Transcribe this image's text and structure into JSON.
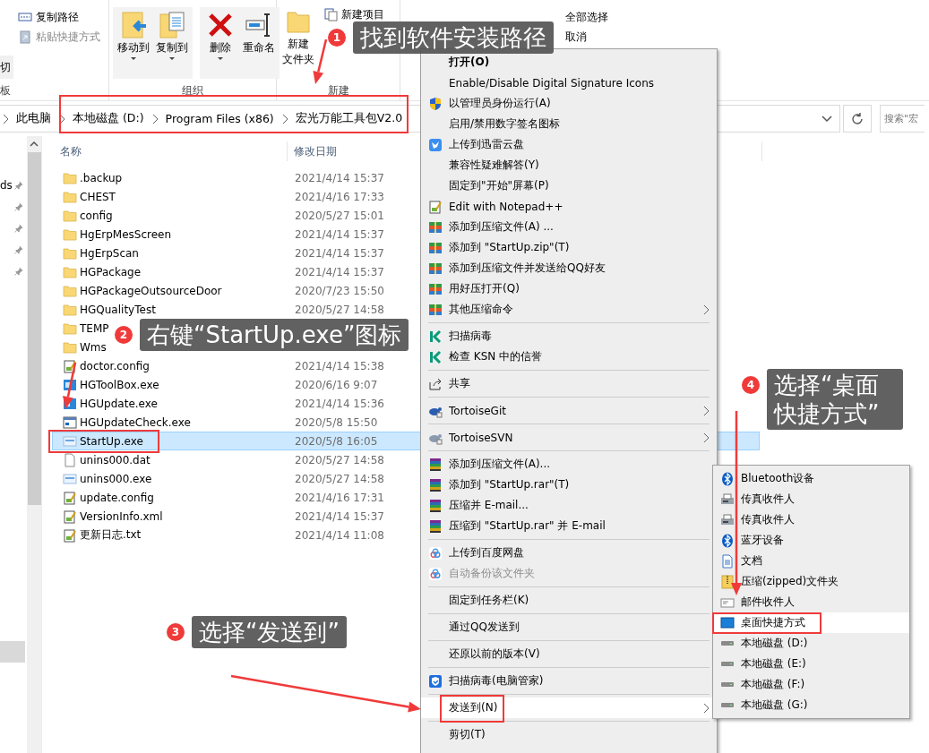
{
  "ribbon": {
    "clipboard": {
      "items": [
        {
          "label": "复制路径",
          "disabled": false
        },
        {
          "label": "粘贴快捷方式",
          "disabled": true
        }
      ],
      "cut": "切",
      "group_label": "板"
    },
    "organize": {
      "buttons": [
        {
          "label": "移动到",
          "dropdown": true
        },
        {
          "label": "复制到",
          "dropdown": true
        },
        {
          "label": "删除",
          "dropdown": true
        },
        {
          "label": "重命名",
          "dropdown": false
        }
      ],
      "group_label": "组织"
    },
    "new": {
      "folder_button": [
        "新建",
        "文件夹"
      ],
      "new_item": "新建项目",
      "group_label": "新建"
    },
    "select": {
      "items": [
        "全部选择",
        "取消"
      ]
    }
  },
  "address_bar": {
    "crumbs": [
      "此电脑",
      "本地磁盘 (D:)",
      "Program Files (x86)",
      "宏光万能工具包V2.0"
    ],
    "search_placeholder": "搜索\"宏"
  },
  "nav_pane": {
    "label": "ds"
  },
  "file_list": {
    "columns": [
      "名称",
      "修改日期"
    ],
    "rows": [
      {
        "name": ".backup",
        "date": "2021/4/14 15:37",
        "kind": "folder",
        "selected": false
      },
      {
        "name": "CHEST",
        "date": "2021/4/16 17:33",
        "kind": "folder",
        "selected": false
      },
      {
        "name": "config",
        "date": "2020/5/27 15:01",
        "kind": "folder",
        "selected": false
      },
      {
        "name": "HgErpMesScreen",
        "date": "2021/4/14 15:37",
        "kind": "folder",
        "selected": false
      },
      {
        "name": "HgErpScan",
        "date": "2021/4/14 15:37",
        "kind": "folder",
        "selected": false
      },
      {
        "name": "HGPackage",
        "date": "2021/4/14 15:37",
        "kind": "folder",
        "selected": false
      },
      {
        "name": "HGPackageOutsourceDoor",
        "date": "2020/7/23 15:50",
        "kind": "folder",
        "selected": false
      },
      {
        "name": "HGQualityTest",
        "date": "2020/5/27 14:58",
        "kind": "folder",
        "selected": false
      },
      {
        "name": "TEMP",
        "kind": "folder",
        "selected": false
      },
      {
        "name": "Wms",
        "kind": "folder",
        "selected": false
      },
      {
        "name": "doctor.config",
        "date": "2021/4/14 15:38",
        "kind": "config",
        "selected": false
      },
      {
        "name": "HGToolBox.exe",
        "date": "2020/6/16 9:07",
        "kind": "exe",
        "selected": false
      },
      {
        "name": "HGUpdate.exe",
        "date": "2021/4/14 15:36",
        "kind": "exe",
        "selected": false
      },
      {
        "name": "HGUpdateCheck.exe",
        "date": "2020/5/8 15:50",
        "kind": "window",
        "selected": false
      },
      {
        "name": "StartUp.exe",
        "date": "2020/5/8 16:05",
        "kind": "app",
        "selected": true
      },
      {
        "name": "unins000.dat",
        "date": "2020/5/27 14:58",
        "kind": "data",
        "selected": false
      },
      {
        "name": "unins000.exe",
        "date": "2020/5/27 14:58",
        "kind": "app",
        "selected": false
      },
      {
        "name": "update.config",
        "date": "2021/4/16 17:31",
        "kind": "config",
        "selected": false
      },
      {
        "name": "VersionInfo.xml",
        "date": "2021/4/14 15:37",
        "kind": "config",
        "selected": false
      },
      {
        "name": "更新日志.txt",
        "date": "2021/4/14 11:08",
        "kind": "config",
        "selected": false
      }
    ]
  },
  "context_menu": {
    "items": [
      {
        "kind": "item",
        "label": "打开(O)",
        "default": true,
        "disabled": false,
        "selected": false,
        "submenu": false
      },
      {
        "kind": "item",
        "label": "Enable/Disable Digital Signature Icons",
        "default": false,
        "disabled": false,
        "selected": false,
        "submenu": false
      },
      {
        "kind": "item",
        "label": "以管理员身份运行(A)",
        "default": false,
        "disabled": false,
        "selected": false,
        "submenu": false
      },
      {
        "kind": "item",
        "label": "启用/禁用数字签名图标",
        "default": false,
        "disabled": false,
        "selected": false,
        "submenu": false
      },
      {
        "kind": "item",
        "label": "上传到迅雷云盘",
        "default": false,
        "disabled": false,
        "selected": false,
        "submenu": false
      },
      {
        "kind": "item",
        "label": "兼容性疑难解答(Y)",
        "default": false,
        "disabled": false,
        "selected": false,
        "submenu": false
      },
      {
        "kind": "item",
        "label": "固定到\"开始\"屏幕(P)",
        "default": false,
        "disabled": false,
        "selected": false,
        "submenu": false
      },
      {
        "kind": "item",
        "label": "Edit with Notepad++",
        "default": false,
        "disabled": false,
        "selected": false,
        "submenu": false
      },
      {
        "kind": "item",
        "label": "添加到压缩文件(A) ...",
        "default": false,
        "disabled": false,
        "selected": false,
        "submenu": false
      },
      {
        "kind": "item",
        "label": "添加到 \"StartUp.zip\"(T)",
        "default": false,
        "disabled": false,
        "selected": false,
        "submenu": false
      },
      {
        "kind": "item",
        "label": "添加到压缩文件并发送给QQ好友",
        "default": false,
        "disabled": false,
        "selected": false,
        "submenu": false
      },
      {
        "kind": "item",
        "label": "用好压打开(Q)",
        "default": false,
        "disabled": false,
        "selected": false,
        "submenu": false
      },
      {
        "kind": "item",
        "label": "其他压缩命令",
        "default": false,
        "disabled": false,
        "selected": false,
        "submenu": true
      },
      {
        "kind": "separator"
      },
      {
        "kind": "item",
        "label": "扫描病毒",
        "default": false,
        "disabled": false,
        "selected": false,
        "submenu": false
      },
      {
        "kind": "item",
        "label": "检查 KSN 中的信誉",
        "default": false,
        "disabled": false,
        "selected": false,
        "submenu": false
      },
      {
        "kind": "separator"
      },
      {
        "kind": "item",
        "label": "共享",
        "default": false,
        "disabled": false,
        "selected": false,
        "submenu": false
      },
      {
        "kind": "separator"
      },
      {
        "kind": "item",
        "label": "TortoiseGit",
        "default": false,
        "disabled": false,
        "selected": false,
        "submenu": true
      },
      {
        "kind": "separator"
      },
      {
        "kind": "item",
        "label": "TortoiseSVN",
        "default": false,
        "disabled": false,
        "selected": false,
        "submenu": true
      },
      {
        "kind": "separator"
      },
      {
        "kind": "item",
        "label": "添加到压缩文件(A)...",
        "default": false,
        "disabled": false,
        "selected": false,
        "submenu": false
      },
      {
        "kind": "item",
        "label": "添加到 \"StartUp.rar\"(T)",
        "default": false,
        "disabled": false,
        "selected": false,
        "submenu": false
      },
      {
        "kind": "item",
        "label": "压缩并 E-mail...",
        "default": false,
        "disabled": false,
        "selected": false,
        "submenu": false
      },
      {
        "kind": "item",
        "label": "压缩到 \"StartUp.rar\" 并 E-mail",
        "default": false,
        "disabled": false,
        "selected": false,
        "submenu": false
      },
      {
        "kind": "separator"
      },
      {
        "kind": "item",
        "label": "上传到百度网盘",
        "default": false,
        "disabled": false,
        "selected": false,
        "submenu": false
      },
      {
        "kind": "item",
        "label": "自动备份该文件夹",
        "default": false,
        "disabled": true,
        "selected": false,
        "submenu": false
      },
      {
        "kind": "separator"
      },
      {
        "kind": "item",
        "label": "固定到任务栏(K)",
        "default": false,
        "disabled": false,
        "selected": false,
        "submenu": false
      },
      {
        "kind": "separator"
      },
      {
        "kind": "item",
        "label": "通过QQ发送到",
        "default": false,
        "disabled": false,
        "selected": false,
        "submenu": false
      },
      {
        "kind": "separator"
      },
      {
        "kind": "item",
        "label": "还原以前的版本(V)",
        "default": false,
        "disabled": false,
        "selected": false,
        "submenu": false
      },
      {
        "kind": "separator"
      },
      {
        "kind": "item",
        "label": "扫描病毒(电脑管家)",
        "default": false,
        "disabled": false,
        "selected": false,
        "submenu": false
      },
      {
        "kind": "separator"
      },
      {
        "kind": "item",
        "label": "发送到(N)",
        "default": false,
        "disabled": false,
        "selected": true,
        "submenu": true
      },
      {
        "kind": "separator"
      },
      {
        "kind": "item",
        "label": "剪切(T)",
        "default": false,
        "disabled": false,
        "selected": false,
        "submenu": false
      }
    ]
  },
  "send_to_menu": {
    "items": [
      {
        "kind": "item",
        "label": "Bluetooth设备",
        "selected": false
      },
      {
        "kind": "item",
        "label": "传真收件人",
        "selected": false
      },
      {
        "kind": "item",
        "label": "传真收件人",
        "selected": false
      },
      {
        "kind": "item",
        "label": "蓝牙设备",
        "selected": false
      },
      {
        "kind": "item",
        "label": "文档",
        "selected": false
      },
      {
        "kind": "item",
        "label": "压缩(zipped)文件夹",
        "selected": false
      },
      {
        "kind": "item",
        "label": "邮件收件人",
        "selected": false
      },
      {
        "kind": "item",
        "label": "桌面快捷方式",
        "selected": true
      },
      {
        "kind": "item",
        "label": "本地磁盘 (D:)",
        "selected": false
      },
      {
        "kind": "item",
        "label": "本地磁盘 (E:)",
        "selected": false
      },
      {
        "kind": "item",
        "label": "本地磁盘 (F:)",
        "selected": false
      },
      {
        "kind": "item",
        "label": "本地磁盘 (G:)",
        "selected": false
      }
    ]
  },
  "callouts": [
    {
      "number": "1",
      "text": "找到软件安装路径"
    },
    {
      "number": "2",
      "text": "右键“StartUp.exe”图标"
    },
    {
      "number": "3",
      "text": "选择“发送到”"
    },
    {
      "number": "4",
      "text": "选择“桌面快捷方式”"
    }
  ]
}
